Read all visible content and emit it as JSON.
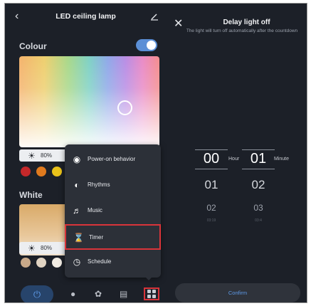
{
  "left": {
    "title": "LED ceiling lamp",
    "back_icon": "chevron-left-icon",
    "edit_icon": "pencil-icon",
    "colour": {
      "label": "Colour",
      "toggle_on": true,
      "brightness": "80%",
      "swatches": [
        "#c4282a",
        "#e07a1e",
        "#e9c21a",
        "#3f8a3a"
      ]
    },
    "white": {
      "label": "White",
      "brightness": "80%",
      "swatches": [
        "#c8a98a",
        "#e0d3c2",
        "#f1ece3"
      ]
    },
    "menu": {
      "items": [
        {
          "label": "Power-on behavior",
          "icon": "power-on-icon"
        },
        {
          "label": "Rhythms",
          "icon": "rhythm-icon"
        },
        {
          "label": "Music",
          "icon": "music-icon"
        },
        {
          "label": "Timer",
          "icon": "hourglass-icon",
          "selected": true
        },
        {
          "label": "Schedule",
          "icon": "clock-icon"
        }
      ]
    },
    "bottom_nav": [
      "power-icon",
      "bulb-icon",
      "palette-icon",
      "scene-icon",
      "grid-icon"
    ]
  },
  "right": {
    "close_icon": "close-icon",
    "title": "Delay light off",
    "subtitle": "The light will turn off automatically after the countdown",
    "hour": {
      "selected": "00",
      "next1": "01",
      "next2": "02",
      "next3": "03:19",
      "unit": "Hour"
    },
    "minute": {
      "selected": "01",
      "next1": "02",
      "next2": "03",
      "next3": "03:4",
      "unit": "Minute"
    },
    "confirm_label": "Confirm"
  },
  "colors": {
    "background": "#1c2028",
    "accent": "#5e9ae8",
    "highlight": "#d9343a"
  }
}
